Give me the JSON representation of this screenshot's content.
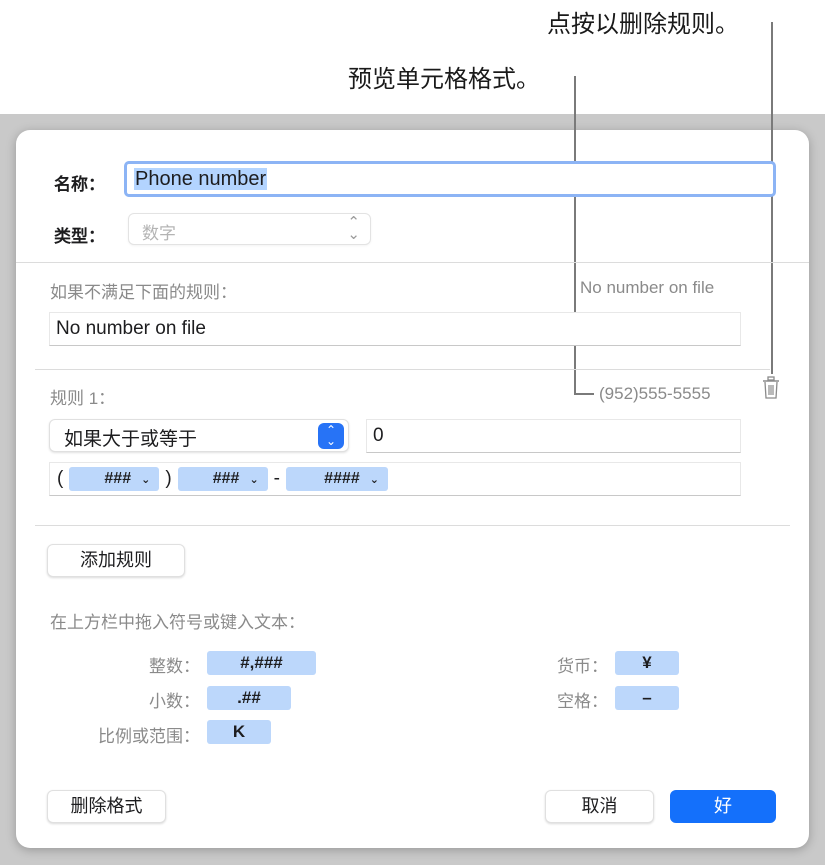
{
  "callouts": {
    "delete_rule": "点按以删除规则。",
    "preview_format": "预览单元格格式。"
  },
  "dialog": {
    "name_label": "名称：",
    "name_value": "Phone number",
    "type_label": "类型：",
    "type_value": "数字",
    "fallback_label": "如果不满足下面的规则：",
    "fallback_preview": "No number on file",
    "fallback_value": "No number on file",
    "rule": {
      "label": "规则 1：",
      "preview": "(952)555-5555",
      "condition": "如果大于或等于",
      "value": "0",
      "tokens": [
        {
          "prefix": "(",
          "label": "###",
          "suffix": ")"
        },
        {
          "prefix": "",
          "label": "###",
          "suffix": "-"
        },
        {
          "prefix": "",
          "label": "####",
          "suffix": ""
        }
      ]
    },
    "add_rule_button": "添加规则",
    "drag_hint": "在上方栏中拖入符号或键入文本：",
    "symbols": {
      "integer_label": "整数：",
      "integer_token": "#,###",
      "decimal_label": "小数：",
      "decimal_token": ".##",
      "scale_label": "比例或范围：",
      "scale_token": "K",
      "currency_label": "货币：",
      "currency_token": "¥",
      "space_label": "空格：",
      "space_token": "–"
    },
    "delete_format_button": "删除格式",
    "cancel_button": "取消",
    "ok_button": "好"
  },
  "colors": {
    "accent": "#1470fb",
    "token_bg": "#bcd7fb",
    "focus_ring": "#8cb4f5"
  }
}
